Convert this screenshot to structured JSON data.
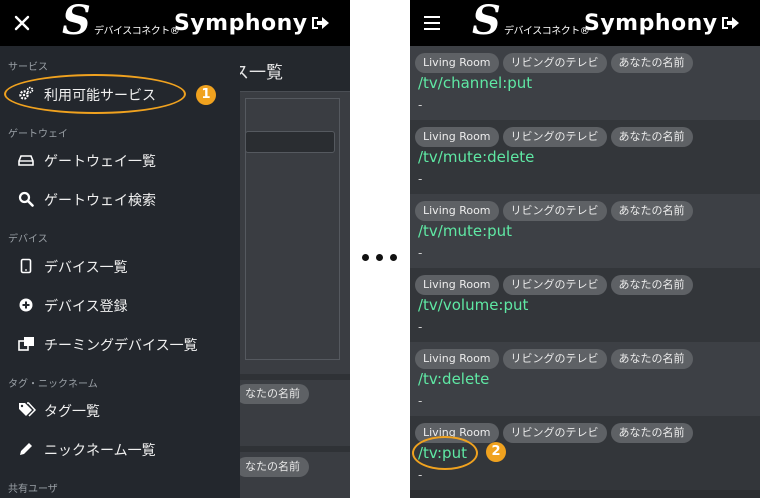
{
  "header": {
    "logo_mark": "S",
    "brand_jp": "デバイスコネクト®",
    "brand_en": "Symphony"
  },
  "left": {
    "background": {
      "page_title_fragment": "ス一覧",
      "chip_fragments": [
        "なたの名前",
        "なたの名前"
      ]
    },
    "drawer": {
      "sections": [
        {
          "title": "サービス",
          "items": [
            {
              "label": "利用可能サービス",
              "icon": "gears-icon"
            }
          ]
        },
        {
          "title": "ゲートウェイ",
          "items": [
            {
              "label": "ゲートウェイ一覧",
              "icon": "hdd-icon"
            },
            {
              "label": "ゲートウェイ検索",
              "icon": "search-icon"
            }
          ]
        },
        {
          "title": "デバイス",
          "items": [
            {
              "label": "デバイス一覧",
              "icon": "tablet-icon"
            },
            {
              "label": "デバイス登録",
              "icon": "plus-circle-icon"
            },
            {
              "label": "チーミングデバイス一覧",
              "icon": "clone-icon"
            }
          ]
        },
        {
          "title": "タグ・ニックネーム",
          "items": [
            {
              "label": "タグ一覧",
              "icon": "tags-icon"
            },
            {
              "label": "ニックネーム一覧",
              "icon": "pencil-icon"
            }
          ]
        },
        {
          "title": "共有ユーザ",
          "items": []
        }
      ]
    }
  },
  "callouts": {
    "first": "1",
    "second": "2"
  },
  "right": {
    "rows": [
      {
        "chips": [
          "Living Room",
          "リビングのテレビ",
          "あなたの名前"
        ],
        "path": "/tv/channel:put",
        "value": "-"
      },
      {
        "chips": [
          "Living Room",
          "リビングのテレビ",
          "あなたの名前"
        ],
        "path": "/tv/mute:delete",
        "value": "-"
      },
      {
        "chips": [
          "Living Room",
          "リビングのテレビ",
          "あなたの名前"
        ],
        "path": "/tv/mute:put",
        "value": "-"
      },
      {
        "chips": [
          "Living Room",
          "リビングのテレビ",
          "あなたの名前"
        ],
        "path": "/tv/volume:put",
        "value": "-"
      },
      {
        "chips": [
          "Living Room",
          "リビングのテレビ",
          "あなたの名前"
        ],
        "path": "/tv:delete",
        "value": "-"
      },
      {
        "chips": [
          "Living Room",
          "リビングのテレビ",
          "あなたの名前"
        ],
        "path": "/tv:put",
        "value": "-"
      }
    ]
  },
  "colors": {
    "accent": "#f0a21f",
    "path_green": "#5fe8a4",
    "header_bg": "#000000",
    "drawer_bg": "#23272d"
  }
}
